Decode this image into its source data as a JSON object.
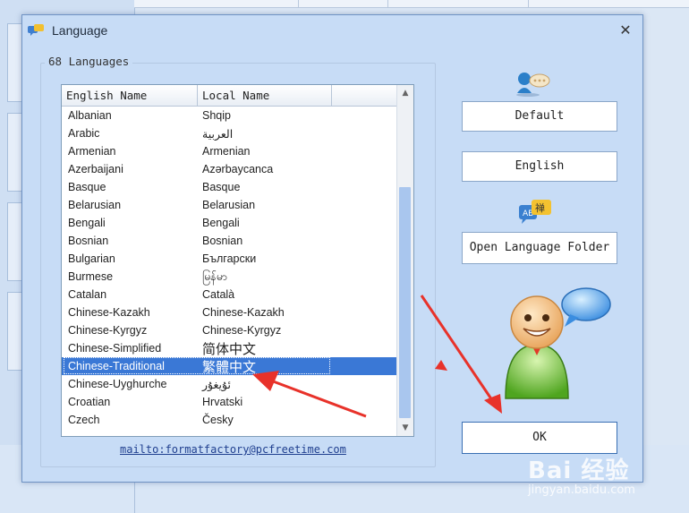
{
  "dialog": {
    "title": "Language",
    "close_glyph": "✕",
    "group_label": "68 Languages",
    "columns": [
      "English Name",
      "Local Name"
    ],
    "rows": [
      {
        "english": "Albanian",
        "local": "Shqip"
      },
      {
        "english": "Arabic",
        "local": "العربية"
      },
      {
        "english": "Armenian",
        "local": "Armenian"
      },
      {
        "english": "Azerbaijani",
        "local": "Azərbaycanca"
      },
      {
        "english": "Basque",
        "local": "Basque"
      },
      {
        "english": "Belarusian",
        "local": "Belarusian"
      },
      {
        "english": "Bengali",
        "local": "Bengali"
      },
      {
        "english": "Bosnian",
        "local": "Bosnian"
      },
      {
        "english": "Bulgarian",
        "local": "Български"
      },
      {
        "english": "Burmese",
        "local": "မြန်မာ"
      },
      {
        "english": "Catalan",
        "local": "Català"
      },
      {
        "english": "Chinese-Kazakh",
        "local": "Chinese-Kazakh"
      },
      {
        "english": "Chinese-Kyrgyz",
        "local": "Chinese-Kyrgyz"
      },
      {
        "english": "Chinese-Simplified",
        "local": "简体中文"
      },
      {
        "english": "Chinese-Traditional",
        "local": "繁體中文"
      },
      {
        "english": "Chinese-Uyghurche",
        "local": "ئۇيغۇر"
      },
      {
        "english": "Croatian",
        "local": "Hrvatski"
      },
      {
        "english": "Czech",
        "local": "Česky"
      }
    ],
    "selected_row": "Chinese-Traditional",
    "mail_link": "mailto:formatfactory@pcfreetime.com",
    "buttons": {
      "default": "Default",
      "english": "English",
      "open_folder": "Open Language Folder",
      "ok": "OK"
    }
  },
  "watermark": {
    "top": "Bai 经验",
    "bottom": "jingyan.baidu.com"
  },
  "colors": {
    "dialog_bg": "#c7dcf6",
    "selection": "#3a78d6",
    "annotation_arrow": "#e8322a"
  }
}
